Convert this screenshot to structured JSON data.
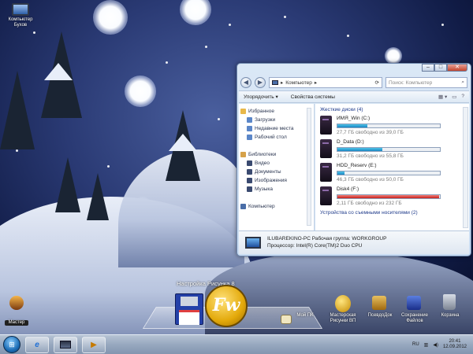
{
  "desktop": {
    "computer_icon_label": "Компьютер\nБухов"
  },
  "explorer": {
    "address_path": "Компьютер",
    "search_placeholder": "Поиск: Компьютер",
    "toolbar": {
      "organize": "Упорядочить",
      "system_properties": "Свойства системы"
    },
    "nav_items": [
      {
        "label": "Избранное",
        "child": false,
        "color": "#e8b84a"
      },
      {
        "label": "Загрузки",
        "child": true,
        "color": "#5b86c8"
      },
      {
        "label": "Недавние места",
        "child": true,
        "color": "#5b86c8"
      },
      {
        "label": "Рабочий стол",
        "child": true,
        "color": "#5b86c8"
      },
      {
        "label": "",
        "child": false,
        "color": "#ffffff"
      },
      {
        "label": "Библиотеки",
        "child": false,
        "color": "#d6a24a"
      },
      {
        "label": "Видео",
        "child": true,
        "color": "#3a4a70"
      },
      {
        "label": "Документы",
        "child": true,
        "color": "#3a4a70"
      },
      {
        "label": "Изображения",
        "child": true,
        "color": "#3a4a70"
      },
      {
        "label": "Музыка",
        "child": true,
        "color": "#3a4a70"
      },
      {
        "label": "",
        "child": false,
        "color": "#ffffff"
      },
      {
        "label": "Компьютер",
        "child": false,
        "color": "#4a6ea8"
      }
    ],
    "group_heading": "Жесткие диски (4)",
    "drives": [
      {
        "name": "ИМЯ_Win (C:)",
        "free": "27,7 ГБ свободно из 39,0 ГБ",
        "used_fraction": 0.29,
        "bar_color": "blue"
      },
      {
        "name": "D_Data (D:)",
        "free": "31,2 ГБ свободно из 55,8 ГБ",
        "used_fraction": 0.44,
        "bar_color": "blue"
      },
      {
        "name": "HDD_Reserv (E:)",
        "free": "46,3 ГБ свободно из 50,0 ГБ",
        "used_fraction": 0.07,
        "bar_color": "blue"
      },
      {
        "name": "Disk4 (F:)",
        "free": "2,11 ГБ свободно из 232 ГБ",
        "used_fraction": 0.99,
        "bar_color": "red"
      }
    ],
    "details": {
      "computer_name": "ILUBAREKINO-PC   Рабочая группа: WORKGROUP",
      "processor": "Процессор: Intel(R) Core(TM)2 Duo CPU"
    },
    "footer_hint": "Устройства со съемными носителями (2)"
  },
  "dock": {
    "title": "Настройка Рисунка 8",
    "items": [
      {
        "label": "Мой ПК",
        "icon": "folder-icon"
      },
      {
        "label": "Мастерская\nРисунки ВП",
        "icon": "bulb-icon"
      },
      {
        "label": "ПсевдоДок",
        "icon": "gear-icon"
      },
      {
        "label": "Сохранение\nФайлов",
        "icon": "save-icon"
      },
      {
        "label": "Корзина",
        "icon": "trash-icon"
      }
    ],
    "left_labels": [
      "Мастер",
      "Быстрые"
    ]
  },
  "taskbar": {
    "start": "⊞",
    "tray_lang": "RU",
    "clock_time": "20:41",
    "clock_date": "12.09.2012"
  }
}
